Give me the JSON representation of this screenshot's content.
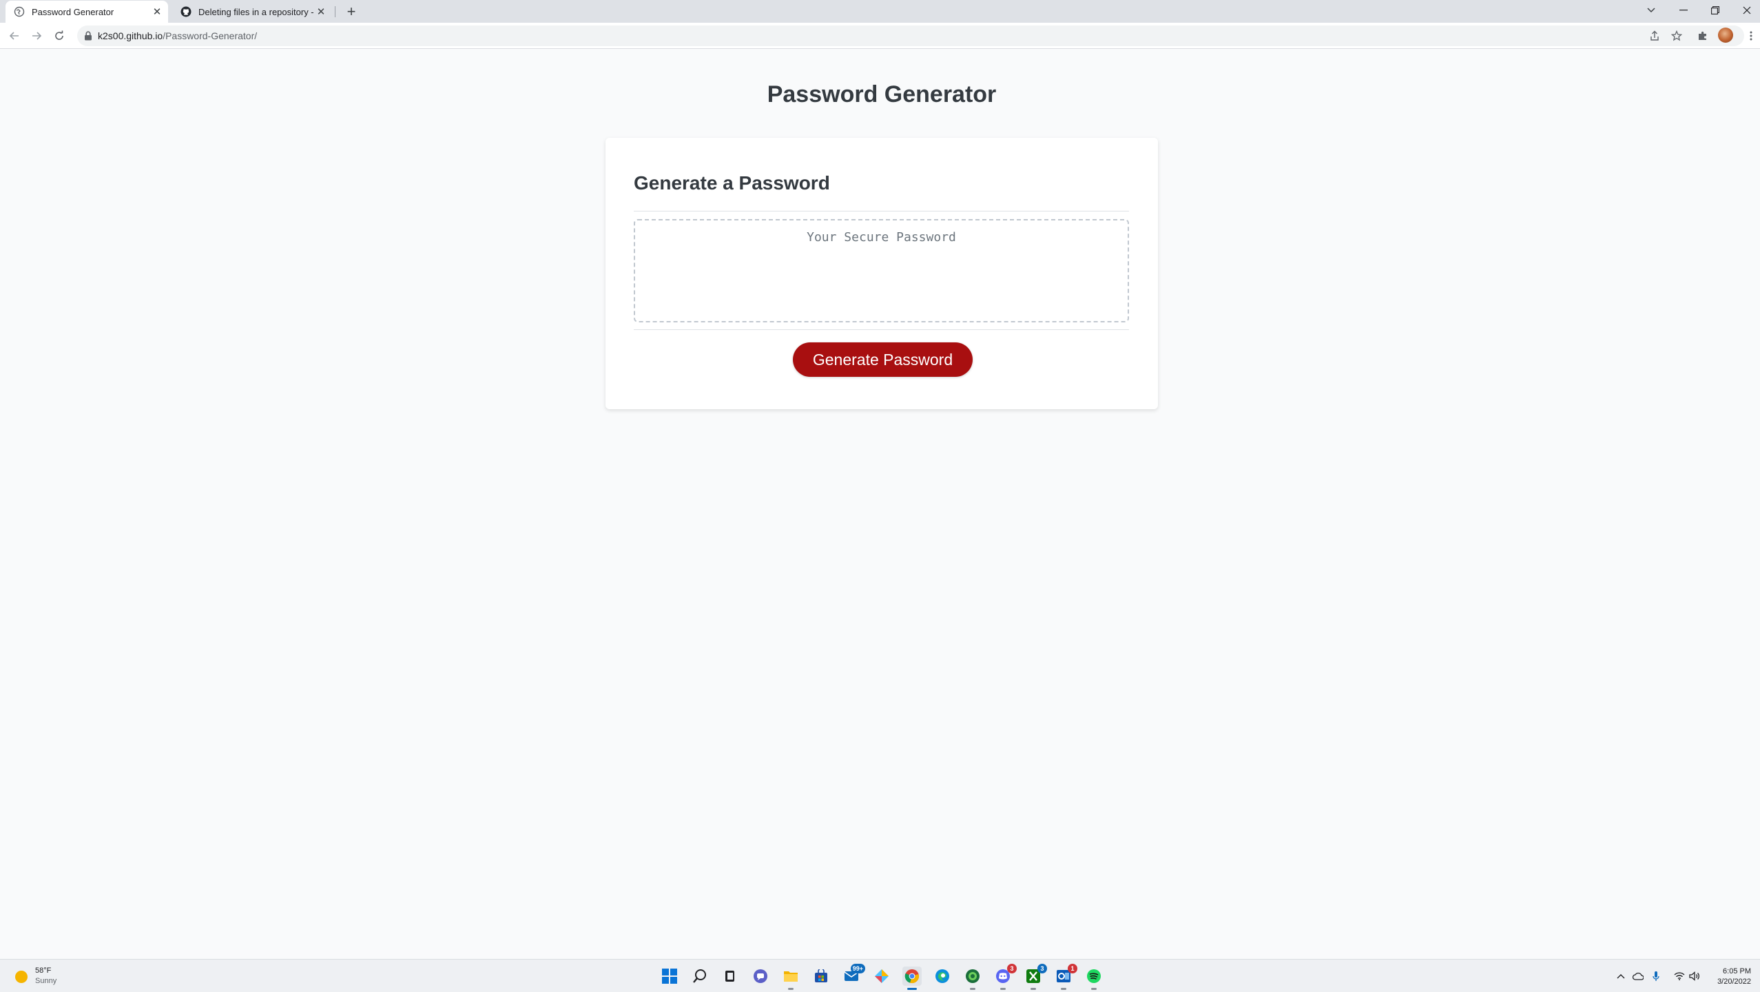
{
  "browser": {
    "tabs": [
      {
        "title": "Password Generator",
        "icon": "globe-icon",
        "active": true
      },
      {
        "title": "Deleting files in a repository - Gi",
        "icon": "github-icon",
        "active": false
      }
    ],
    "new_tab_symbol": "+",
    "url_host": "k2s00.github.io",
    "url_path": "/Password-Generator/"
  },
  "page": {
    "title": "Password Generator",
    "card_header": "Generate a Password",
    "password_placeholder": "Your Secure Password",
    "password_value": "",
    "generate_button": "Generate Password",
    "button_color": "#a80f10"
  },
  "taskbar": {
    "weather": {
      "temp": "58°F",
      "desc": "Sunny",
      "icon": "sun-icon"
    },
    "apps": [
      {
        "name": "start-icon"
      },
      {
        "name": "search-icon"
      },
      {
        "name": "task-view-icon"
      },
      {
        "name": "teams-chat-icon"
      },
      {
        "name": "file-explorer-icon"
      },
      {
        "name": "store-icon"
      },
      {
        "name": "mail-icon",
        "badge": "99+"
      },
      {
        "name": "pinned-app-icon"
      },
      {
        "name": "chrome-icon"
      },
      {
        "name": "edge-icon"
      },
      {
        "name": "edge-dev-icon"
      },
      {
        "name": "discord-icon",
        "badge": "3"
      },
      {
        "name": "xbox-icon",
        "badge": "3"
      },
      {
        "name": "outlook-icon",
        "badge": "1"
      },
      {
        "name": "spotify-icon"
      }
    ],
    "time": "6:05 PM",
    "date": "3/20/2022"
  }
}
